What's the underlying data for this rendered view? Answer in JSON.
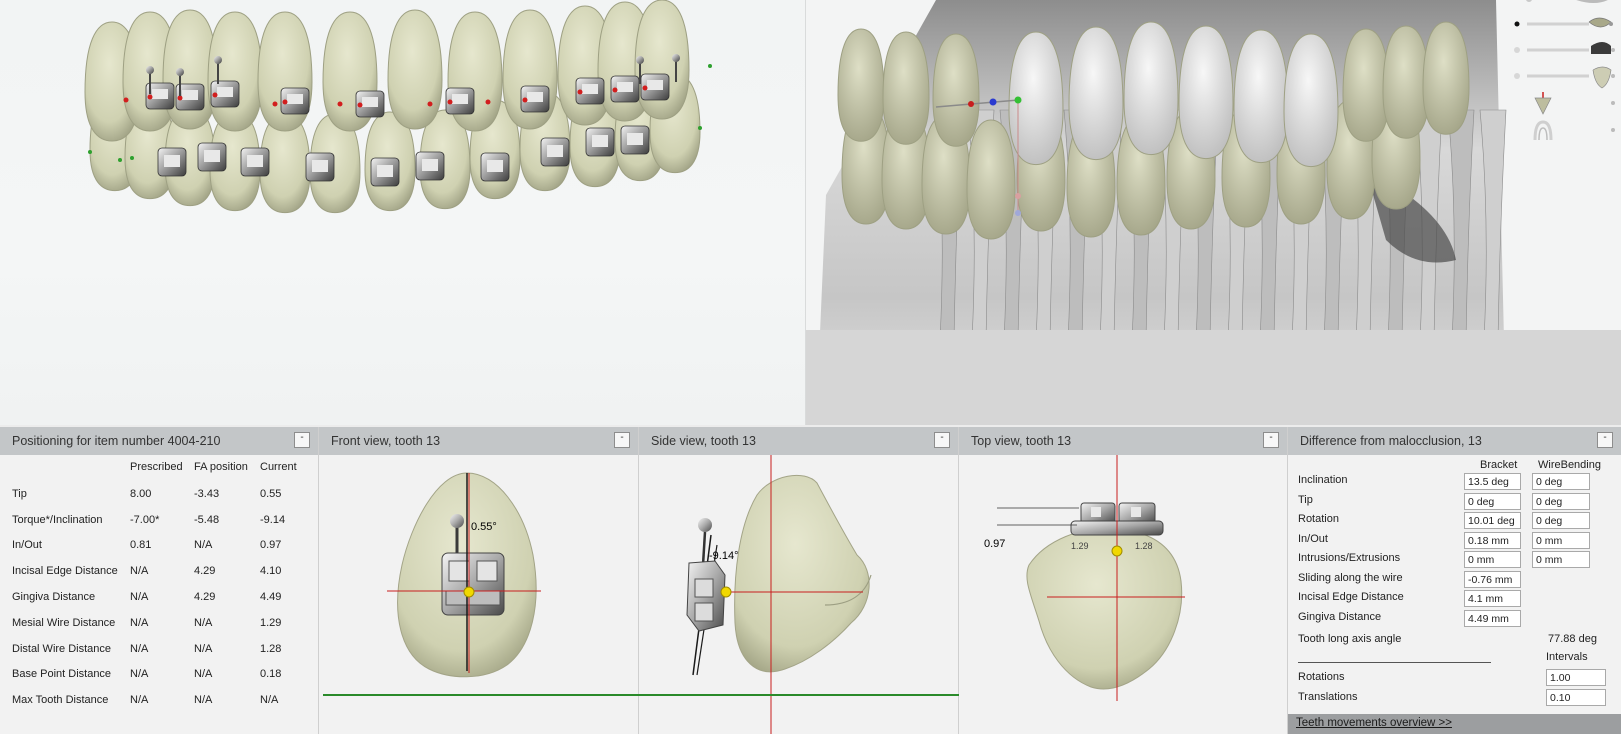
{
  "positioning": {
    "title": "Positioning for item number 4004-210",
    "minimize": "-",
    "columns": [
      "Prescribed",
      "FA position",
      "Current"
    ],
    "rows": [
      {
        "label": "Tip",
        "values": [
          "8.00",
          "-3.43",
          "0.55"
        ]
      },
      {
        "label": "Torque*/Inclination",
        "values": [
          "-7.00*",
          "-5.48",
          "-9.14"
        ]
      },
      {
        "label": "In/Out",
        "values": [
          "0.81",
          "N/A",
          "0.97"
        ]
      },
      {
        "label": "Incisal Edge Distance",
        "values": [
          "N/A",
          "4.29",
          "4.10"
        ]
      },
      {
        "label": "Gingiva Distance",
        "values": [
          "N/A",
          "4.29",
          "4.49"
        ]
      },
      {
        "label": "Mesial Wire Distance",
        "values": [
          "N/A",
          "N/A",
          "1.29"
        ]
      },
      {
        "label": "Distal Wire Distance",
        "values": [
          "N/A",
          "N/A",
          "1.28"
        ]
      },
      {
        "label": "Base Point Distance",
        "values": [
          "N/A",
          "N/A",
          "0.18"
        ]
      },
      {
        "label": "Max Tooth Distance",
        "values": [
          "N/A",
          "N/A",
          "N/A"
        ]
      }
    ]
  },
  "front_view": {
    "title": "Front view, tooth 13",
    "minimize": "-",
    "angle": "0.55°"
  },
  "side_view": {
    "title": "Side view, tooth 13",
    "minimize": "-",
    "angle": "-9.14°"
  },
  "top_view": {
    "title": "Top view, tooth 13",
    "minimize": "-",
    "distance": "0.97",
    "left_mark": "1.29",
    "right_mark": "1.28"
  },
  "difference": {
    "title": "Difference from malocclusion, 13",
    "minimize": "-",
    "col_bracket": "Bracket",
    "col_wire": "WireBending",
    "rows": [
      {
        "label": "Inclination",
        "bracket": "13.5 deg",
        "wire": "0 deg"
      },
      {
        "label": "Tip",
        "bracket": "0 deg",
        "wire": "0 deg"
      },
      {
        "label": "Rotation",
        "bracket": "10.01 deg",
        "wire": "0 deg"
      },
      {
        "label": "In/Out",
        "bracket": "0.18 mm",
        "wire": "0 mm"
      },
      {
        "label": "Intrusions/Extrusions",
        "bracket": "0 mm",
        "wire": "0 mm"
      },
      {
        "label": "Sliding along the wire",
        "bracket": "-0.76 mm"
      },
      {
        "label": "Incisal Edge Distance",
        "bracket": "4.1 mm"
      },
      {
        "label": "Gingiva Distance",
        "bracket": "4.49 mm"
      }
    ],
    "tooth_long_axis_label": "Tooth long axis angle",
    "tooth_long_axis_value": "77.88 deg",
    "intervals_label": "Intervals",
    "rotations_label": "Rotations",
    "rotations_value": "1.00",
    "translations_label": "Translations",
    "translations_value": "0.10",
    "footer_link": "Teeth movements overview >>"
  },
  "colors": {
    "tooth": "#d9dbbf",
    "tooth_shadow": "#a9ab8c",
    "axis_red": "#c81e1e",
    "ground_green": "#2a8a2a",
    "header": "#c3c6c8"
  },
  "icons": [
    "lower-jaw-icon",
    "upper-jaw-icon",
    "tooth-shape-icon",
    "tooth-slider-icon",
    "root-arrow-icon",
    "arch-icon"
  ]
}
